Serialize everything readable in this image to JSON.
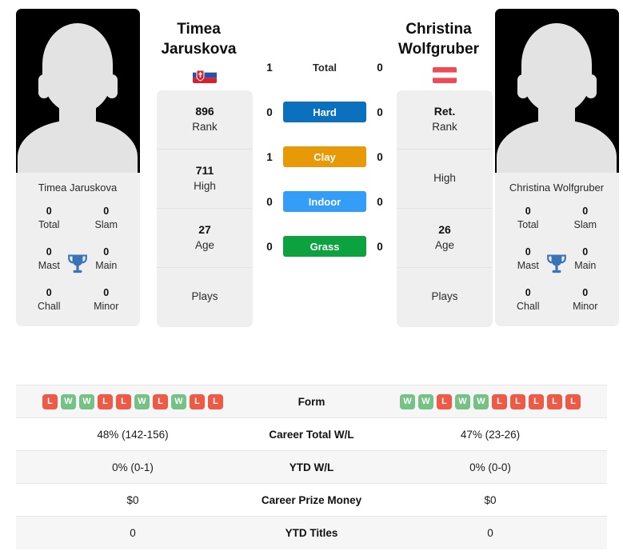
{
  "players": {
    "left": {
      "first_name": "Timea",
      "last_name": "Jaruskova",
      "full_name": "Timea Jaruskova",
      "country_flag": "slovakia-flag",
      "rank": "896",
      "rank_label": "Rank",
      "high": "711",
      "high_label": "High",
      "age": "27",
      "age_label": "Age",
      "plays": "",
      "plays_label": "Plays",
      "titles": [
        {
          "value": "0",
          "label": "Total"
        },
        {
          "value": "0",
          "label": "Slam"
        },
        {
          "value": "0",
          "label": "Mast"
        },
        {
          "value": "0",
          "label": "Main"
        },
        {
          "value": "0",
          "label": "Chall"
        },
        {
          "value": "0",
          "label": "Minor"
        }
      ],
      "form": [
        "L",
        "W",
        "W",
        "L",
        "L",
        "W",
        "L",
        "W",
        "L",
        "L"
      ],
      "career_total_wl": "48% (142-156)",
      "ytd_wl": "0% (0-1)",
      "career_prize_money": "$0",
      "ytd_titles": "0"
    },
    "right": {
      "first_name": "Christina",
      "last_name": "Wolfgruber",
      "full_name": "Christina Wolfgruber",
      "country_flag": "austria-flag",
      "rank": "Ret.",
      "rank_label": "Rank",
      "high": "",
      "high_label": "High",
      "age": "26",
      "age_label": "Age",
      "plays": "",
      "plays_label": "Plays",
      "titles": [
        {
          "value": "0",
          "label": "Total"
        },
        {
          "value": "0",
          "label": "Slam"
        },
        {
          "value": "0",
          "label": "Mast"
        },
        {
          "value": "0",
          "label": "Main"
        },
        {
          "value": "0",
          "label": "Chall"
        },
        {
          "value": "0",
          "label": "Minor"
        }
      ],
      "form": [
        "W",
        "W",
        "L",
        "W",
        "W",
        "L",
        "L",
        "L",
        "L",
        "L"
      ],
      "career_total_wl": "47% (23-26)",
      "ytd_wl": "0% (0-0)",
      "career_prize_money": "$0",
      "ytd_titles": "0"
    }
  },
  "head_to_head": [
    {
      "label": "Total",
      "left": "1",
      "right": "0",
      "surface": false,
      "color": ""
    },
    {
      "label": "Hard",
      "left": "0",
      "right": "0",
      "surface": true,
      "color": "#0b70bd"
    },
    {
      "label": "Clay",
      "left": "1",
      "right": "0",
      "surface": true,
      "color": "#e89908"
    },
    {
      "label": "Indoor",
      "left": "0",
      "right": "0",
      "surface": true,
      "color": "#339df7"
    },
    {
      "label": "Grass",
      "left": "0",
      "right": "0",
      "surface": true,
      "color": "#0ba23f"
    }
  ],
  "stats_rows": [
    {
      "label": "Form",
      "type": "form"
    },
    {
      "label": "Career Total W/L",
      "type": "text",
      "key": "career_total_wl"
    },
    {
      "label": "YTD W/L",
      "type": "text",
      "key": "ytd_wl"
    },
    {
      "label": "Career Prize Money",
      "type": "text",
      "key": "career_prize_money"
    },
    {
      "label": "YTD Titles",
      "type": "text",
      "key": "ytd_titles"
    }
  ],
  "colors": {
    "hard": "#0b70bd",
    "clay": "#e89908",
    "indoor": "#339df7",
    "grass": "#0ba23f",
    "win_badge": "#74c285",
    "loss_badge": "#ee5a45",
    "card_bg": "#efefef",
    "trophy": "#3b73b9"
  }
}
